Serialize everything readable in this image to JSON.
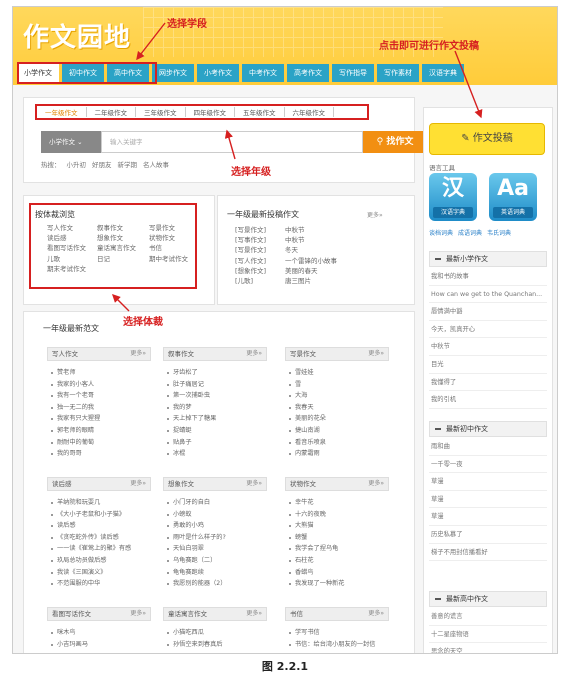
{
  "header": {
    "logo": "作文园地",
    "nav": [
      "小学作文",
      "初中作文",
      "高中作文",
      "网步作文",
      "小考作文",
      "中考作文",
      "高考作文",
      "写作指导",
      "写作素材",
      "汉语字典"
    ]
  },
  "annotations": {
    "select_stage": "选择学段",
    "submit_hint": "点击即可进行作文投稿",
    "select_grade": "选择年级",
    "select_genre": "选择体裁"
  },
  "grades": [
    "一年级作文",
    "二年级作文",
    "三年级作文",
    "四年级作文",
    "五年级作文",
    "六年级作文"
  ],
  "search": {
    "select": "小学作文 ⌄",
    "placeholder": "输入关键字",
    "button": "找作文"
  },
  "hot": {
    "label": "热搜：",
    "items": [
      "小升初",
      "好朋友",
      "新学期",
      "名人故事"
    ]
  },
  "genre_box": {
    "title": "按体裁浏览",
    "col1": [
      "写人作文",
      "读后感",
      "看图写话作文",
      "儿歌",
      "期末考试作文"
    ],
    "col2": [
      "叙事作文",
      "想象作文",
      "童话寓言作文",
      "日记"
    ],
    "col3": [
      "写景作文",
      "状物作文",
      "书信",
      "期中考试作文"
    ]
  },
  "latest": {
    "title": "一年级最新投稿作文",
    "more": "更多»",
    "items": [
      [
        "[写景作文]",
        "中秋节"
      ],
      [
        "[写事作文]",
        "中秋节"
      ],
      [
        "[写景作文]",
        "冬天"
      ],
      [
        "[写人作文]",
        "一个雷锋的小故事"
      ],
      [
        "[想象作文]",
        "美丽的春天"
      ],
      [
        "[儿歌]",
        "唐三图片"
      ]
    ]
  },
  "fanwen": {
    "title": "一年级最新范文",
    "more": "更多»",
    "row1": [
      {
        "head": "写人作文",
        "items": [
          "赞老师",
          "我家的小客人",
          "我有一个老哥",
          "独一无二的我",
          "我家有只大猩猩",
          "郭老师的眼睛",
          "耐耐中的葡萄",
          "我的哥哥"
        ]
      },
      {
        "head": "叙事作文",
        "items": [
          "牙齿松了",
          "肚子痛居记",
          "第一次捕卧虫",
          "我的梦",
          "天上掉下了糖果",
          "捉蜻蜓",
          "贴鼻子",
          "冰棍"
        ]
      },
      {
        "head": "写景作文",
        "items": [
          "雪娃娃",
          "雪",
          "大海",
          "我春天",
          "美丽的花朵",
          "捷山南湖",
          "看音乐喷泉",
          "内蒙霜雨"
        ]
      }
    ],
    "row2": [
      {
        "head": "读后感",
        "items": [
          "羊纳院和玩耍几",
          "《大小子老鼠和小子猫》",
          "读后感",
          "《贪吃蛇外传》读后感",
          "一一读《崔莺上的聚》有感",
          "玖局总功员做后感",
          "我读《三国演义》",
          "不范围服的中华"
        ]
      },
      {
        "head": "想象作文",
        "items": [
          "小门牙的自白",
          "小螃蚁",
          "勇敢的小鸡",
          "雨叶是什么样子的?",
          "天仙白羽翠",
          "乌龟赛跑（二）",
          "龟龟赛跑续",
          "我愿别的能器（2）"
        ]
      },
      {
        "head": "状物作文",
        "items": [
          "幸牛花",
          "十六的夜晚",
          "大熊猫",
          "螃蟹",
          "我学会了捏乌龟",
          "石柱花",
          "香蜡鸟",
          "我发现了一种新花"
        ]
      }
    ],
    "row3": [
      {
        "head": "看图写话作文",
        "items": [
          "咪木鸟",
          "小吉玛画马"
        ]
      },
      {
        "head": "童话寓言作文",
        "items": [
          "小猫吃西瓜",
          "孙悟空来到春真后"
        ]
      },
      {
        "head": "书信",
        "items": [
          "学写书信",
          "书信：给台湾小朋友的一封信"
        ]
      }
    ]
  },
  "sidebar": {
    "submit": "作文投稿",
    "lang_tools": "语言工具",
    "dict1": {
      "glyph": "汉",
      "label": "汉语字典"
    },
    "dict2": {
      "glyph": "Aa",
      "label": "英语词典"
    },
    "links": [
      "谈档词典",
      "成语词典",
      "韦氏词典"
    ],
    "primary_title": "最新小学作文",
    "primary": [
      "我和书的故事",
      "How can we get to the Quanchan...",
      "唇情满中豁",
      "今天，凯真开心",
      "中秋节",
      "目光",
      "我懂得了",
      "我的引机"
    ],
    "junior_title": "最新初中作文",
    "junior": [
      "雨和曲",
      "一千零一夜",
      "草漫",
      "草漫",
      "草漫",
      "历史私慕了",
      "梯子不用封信播看好"
    ],
    "senior_title": "最新高中作文",
    "senior": [
      "善意的谎言",
      "十二星座物语",
      "思念的天空"
    ]
  },
  "caption": "图 2.2.1",
  "colors": {
    "accent": "#2ba3c6",
    "brand": "#ffcc3a",
    "orange": "#f28f12",
    "annotation": "#d62020"
  }
}
